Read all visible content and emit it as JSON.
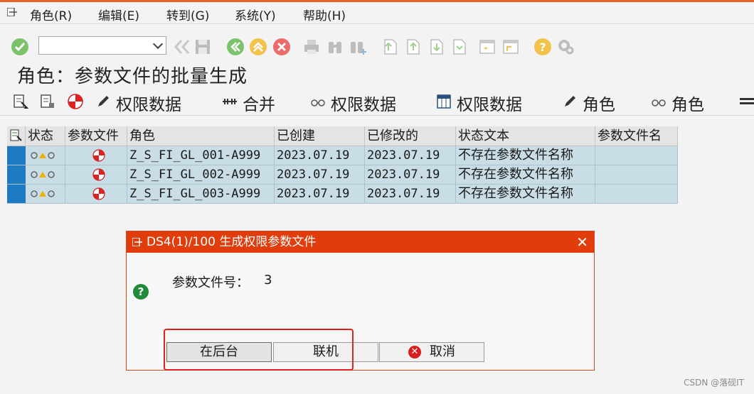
{
  "menubar": {
    "items": [
      "角色(R)",
      "编辑(E)",
      "转到(G)",
      "系统(Y)",
      "帮助(H)"
    ]
  },
  "toolbar": {
    "command_value": ""
  },
  "page": {
    "title": "角色：参数文件的批量生成"
  },
  "app_toolbar": {
    "items": [
      "权限数据",
      "合并",
      "权限数据",
      "权限数据",
      "角色",
      "角色"
    ]
  },
  "table": {
    "headers": [
      "状态",
      "参数文件",
      "角色",
      "已创建",
      "已修改的",
      "状态文本",
      "参数文件名"
    ],
    "rows": [
      {
        "role": "Z_S_FI_GL_001-A999",
        "created": "2023.07.19",
        "modified": "2023.07.19",
        "status_text": "不存在参数文件名称",
        "profile_name": ""
      },
      {
        "role": "Z_S_FI_GL_002-A999",
        "created": "2023.07.19",
        "modified": "2023.07.19",
        "status_text": "不存在参数文件名称",
        "profile_name": ""
      },
      {
        "role": "Z_S_FI_GL_003-A999",
        "created": "2023.07.19",
        "modified": "2023.07.19",
        "status_text": "不存在参数文件名称",
        "profile_name": ""
      }
    ]
  },
  "dialog": {
    "title": "DS4(1)/100 生成权限参数文件",
    "close_glyph": "✕",
    "question_glyph": "?",
    "field_label": "参数文件号：",
    "field_value": "3",
    "buttons": {
      "background": "在后台",
      "online": "联机",
      "cancel": "取消"
    }
  },
  "watermark": "CSDN @落砚IT",
  "colors": {
    "accent": "#e03c0c",
    "selection": "#1f7ac2",
    "row_bg": "#c8dde6",
    "highlight_box": "#e51f1f"
  }
}
